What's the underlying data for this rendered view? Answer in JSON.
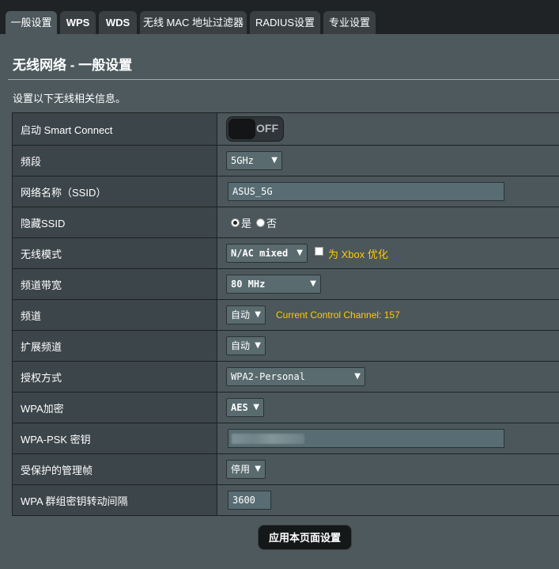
{
  "tabs": [
    {
      "label": "一般设置"
    },
    {
      "label": "WPS"
    },
    {
      "label": "WDS"
    },
    {
      "label": "无线 MAC 地址过滤器"
    },
    {
      "label": "RADIUS设置"
    },
    {
      "label": "专业设置"
    }
  ],
  "page": {
    "title": "无线网络 - 一般设置",
    "description": "设置以下无线相关信息。"
  },
  "rows": {
    "smart_connect": {
      "label": "启动 Smart Connect",
      "toggle_text": "OFF"
    },
    "band": {
      "label": "频段",
      "value": "5GHz"
    },
    "ssid": {
      "label": "网络名称（SSID）",
      "value": "ASUS_5G"
    },
    "hide_ssid": {
      "label": "隐藏SSID",
      "option_yes": "是",
      "option_no": "否",
      "selected": "是"
    },
    "wireless_mode": {
      "label": "无线模式",
      "value": "N/AC mixed",
      "checkbox_label": "为 Xbox 优化"
    },
    "channel_bandwidth": {
      "label": "频道带宽",
      "value": "80 MHz"
    },
    "channel": {
      "label": "频道",
      "value": "自动",
      "info": "Current Control Channel: 157"
    },
    "extension_channel": {
      "label": "扩展频道",
      "value": "自动"
    },
    "auth_method": {
      "label": "授权方式",
      "value": "WPA2-Personal"
    },
    "wpa_encryption": {
      "label": "WPA加密",
      "value": "AES"
    },
    "wpa_psk": {
      "label": "WPA-PSK 密钥"
    },
    "pmf": {
      "label": "受保护的管理帧",
      "value": "停用"
    },
    "group_key_interval": {
      "label": "WPA 群组密钥转动间隔",
      "value": "3600"
    }
  },
  "apply_button": "应用本页面设置",
  "colors": {
    "background": "#4d595d",
    "tab_bar": "#1f2326",
    "label_cell": "#3c4549",
    "accent_text": "#ffcc00"
  }
}
